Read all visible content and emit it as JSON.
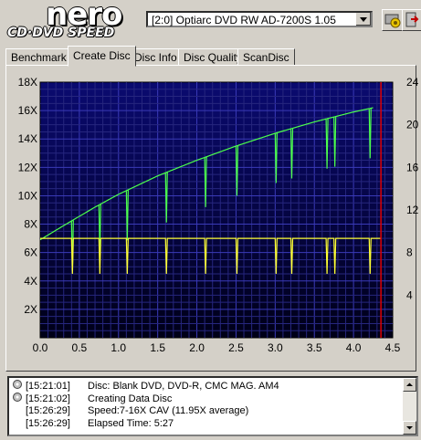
{
  "app": {
    "logo_main": "nero",
    "logo_sub": "CD·DVD SPEED"
  },
  "drive_select": {
    "value": "[2:0]  Optiarc DVD RW AD-7200S 1.05"
  },
  "tabs": [
    {
      "label": "Benchmark"
    },
    {
      "label": "Create Disc"
    },
    {
      "label": "Disc Info"
    },
    {
      "label": "Disc Quality"
    },
    {
      "label": "ScanDisc"
    }
  ],
  "colors": {
    "plot_bg_top": "#0a0a6e",
    "grid": "#3a3aa8",
    "speed_line": "#4cff4c",
    "rpm_line": "#ffff33",
    "marker": "#e00000"
  },
  "chart_data": {
    "type": "line",
    "xlim": [
      0,
      4.5
    ],
    "x_ticks": [
      "0.0",
      "0.5",
      "1.0",
      "1.5",
      "2.0",
      "2.5",
      "3.0",
      "3.5",
      "4.0",
      "4.5"
    ],
    "y_left_ticks": [
      "2X",
      "4X",
      "6X",
      "8X",
      "10X",
      "12X",
      "14X",
      "16X",
      "18X"
    ],
    "y_left_lim": [
      0,
      18
    ],
    "y_right_ticks": [
      "4",
      "8",
      "12",
      "16",
      "20",
      "24"
    ],
    "y_right_lim": [
      0,
      24
    ],
    "marker_x": 4.35,
    "series": [
      {
        "x": [
          0.0,
          0.3,
          0.7,
          1.0,
          1.5,
          2.0,
          2.5,
          3.0,
          3.5,
          4.0,
          4.25
        ],
        "y": [
          6.9,
          7.9,
          9.2,
          10.1,
          11.4,
          12.5,
          13.5,
          14.4,
          15.2,
          15.9,
          16.2
        ]
      },
      {
        "x": [
          0.0,
          4.35
        ],
        "y": [
          7.0,
          7.0
        ]
      }
    ],
    "dips_at": [
      0.4,
      0.75,
      1.1,
      1.6,
      2.1,
      2.5,
      3.0,
      3.2,
      3.65,
      3.75,
      4.2
    ]
  },
  "log": [
    {
      "icon": "disc-icon",
      "time": "[15:21:01]",
      "text": "Disc: Blank DVD, DVD-R, CMC MAG. AM4"
    },
    {
      "icon": "disc-icon",
      "time": "[15:21:02]",
      "text": "Creating Data Disc"
    },
    {
      "icon": "",
      "time": "[15:26:29]",
      "text": "Speed:7-16X CAV (11.95X average)"
    },
    {
      "icon": "",
      "time": "[15:26:29]",
      "text": "Elapsed Time:  5:27"
    }
  ]
}
